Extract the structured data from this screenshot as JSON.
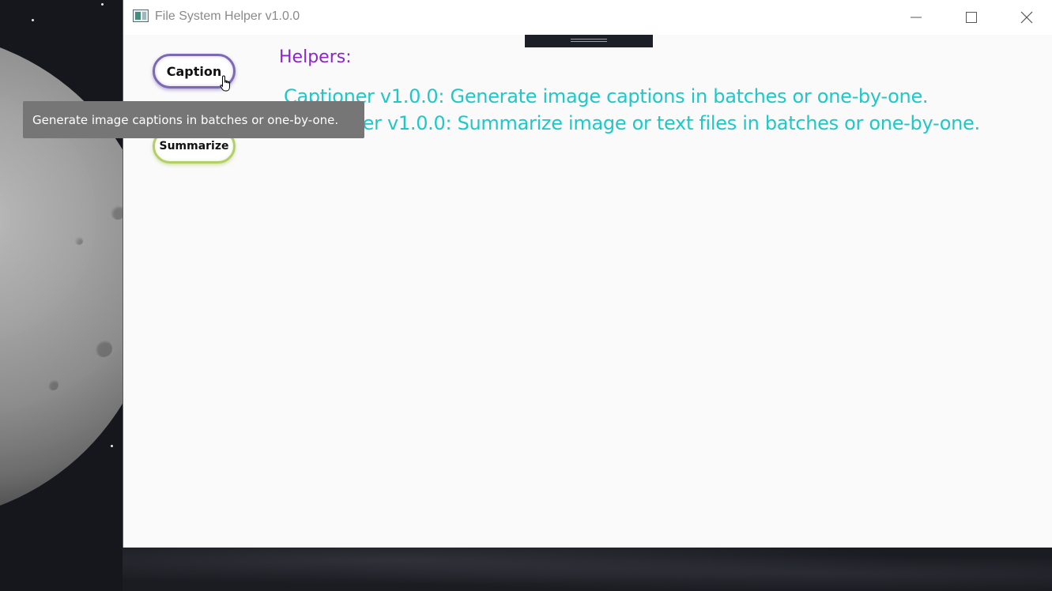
{
  "window": {
    "title": "File System Helper v1.0.0"
  },
  "nav": {
    "caption_label": "Caption",
    "summarize_label": "Summarize"
  },
  "main": {
    "heading": "Helpers:",
    "helpers": [
      "Captioner v1.0.0: Generate image captions in batches or one-by-one.",
      "Summarizer v1.0.0: Summarize image or text files in batches or one-by-one."
    ]
  },
  "tooltip": {
    "text": "Generate image captions in batches or one-by-one."
  },
  "colors": {
    "heading": "#8e24c9",
    "helper_text": "#1fc8c8",
    "caption_border": "#7d68b3",
    "summarize_border": "#b4cf6a",
    "tooltip_bg": "#767676"
  },
  "icons": {
    "app": "app-window-icon",
    "minimize": "minimize-icon",
    "maximize": "maximize-icon",
    "close": "close-icon",
    "cursor": "hand-pointer-icon"
  }
}
